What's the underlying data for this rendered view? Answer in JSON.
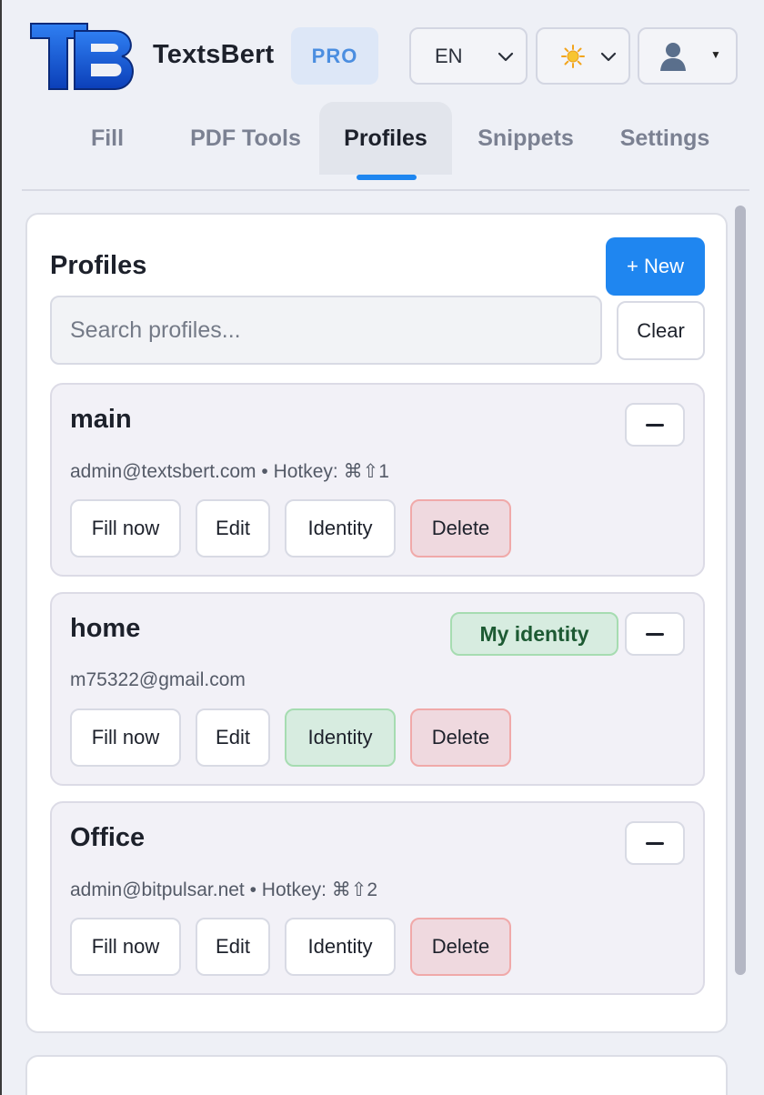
{
  "app": {
    "name": "TextsBert",
    "badge": "PRO",
    "language": "EN",
    "theme_icon": "sun-icon",
    "user_icon": "user-icon"
  },
  "tabs": [
    {
      "label": "Fill"
    },
    {
      "label": "PDF Tools"
    },
    {
      "label": "Profiles",
      "active": true
    },
    {
      "label": "Snippets"
    },
    {
      "label": "Settings"
    }
  ],
  "profiles_panel": {
    "title": "Profiles",
    "new_label": "+ New",
    "search_placeholder": "Search profiles...",
    "search_value": "",
    "clear_label": "Clear"
  },
  "profiles": [
    {
      "name": "main",
      "meta": "admin@textsbert.com • Hotkey: ⌘⇧1",
      "actions": {
        "fill": "Fill now",
        "edit": "Edit",
        "identity": "Identity",
        "delete": "Delete"
      }
    },
    {
      "name": "home",
      "meta": "m75322@gmail.com",
      "badge": "My identity",
      "identity_active": true,
      "actions": {
        "fill": "Fill now",
        "edit": "Edit",
        "identity": "Identity",
        "delete": "Delete"
      }
    },
    {
      "name": "Office",
      "meta": "admin@bitpulsar.net • Hotkey: ⌘⇧2",
      "actions": {
        "fill": "Fill now",
        "edit": "Edit",
        "identity": "Identity",
        "delete": "Delete"
      }
    }
  ],
  "colors": {
    "accent": "#1f86f0",
    "badge_bg": "#dde7f7",
    "identity_bg": "#d7ece0",
    "delete_bg": "#efd9df"
  }
}
